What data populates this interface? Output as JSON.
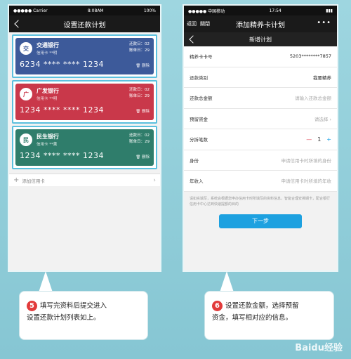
{
  "left": {
    "status": {
      "carrier": "●●●●● Carrier",
      "time": "8:08AM",
      "battery": "100%"
    },
    "title": "设置还款计划",
    "cards": [
      {
        "logo": "交",
        "name": "交通银行",
        "sub": "信用卡      **明",
        "repay_day": "还款日：02",
        "bill_day": "账单日：29",
        "number": "6234 **** **** 1234",
        "delete": "删除"
      },
      {
        "logo": "广",
        "name": "广发银行",
        "sub": "信用卡      **明",
        "repay_day": "还款日：02",
        "bill_day": "账单日：29",
        "number": "1234 **** **** 1234",
        "delete": "删除"
      },
      {
        "logo": "民",
        "name": "民生银行",
        "sub": "信用卡      **薰",
        "repay_day": "还款日：02",
        "bill_day": "账单日：29",
        "number": "1234 **** **** 1234",
        "delete": "删除"
      }
    ],
    "add_card": "添加信用卡"
  },
  "right": {
    "status": {
      "carrier": "●●●●● 中国移动",
      "time": "17:54"
    },
    "nav_back": "返回",
    "nav_close": "關閉",
    "title": "添加精养卡计划",
    "subtitle": "新增计划",
    "rows": [
      {
        "label": "精养卡卡号",
        "value": "5203********7857"
      },
      {
        "label": "还款类别",
        "value": "我要精养"
      },
      {
        "label": "还款总金额",
        "value": "请输入还款总金额"
      },
      {
        "label": "预留资金",
        "value": "请选择"
      },
      {
        "label": "分拆笔数",
        "value": "1"
      },
      {
        "label": "身份",
        "value": "申请信用卡时所填的身份"
      },
      {
        "label": "年收入",
        "value": "申请信用卡时所填的年收"
      }
    ],
    "note": "请如实填写，系统会根据您申办信用卡时所填写的资料信息，智能合理安排期卡，配合银行信用卡中心达到快速提额的目的",
    "next": "下一步"
  },
  "callouts": {
    "left": {
      "num": "5",
      "line1": "填写完资料后提交进入",
      "line2": "设置还款计划列表如上。"
    },
    "right": {
      "num": "6",
      "line1": "设置还款金额，选择预留",
      "line2": "资金，填写相对应的信息。"
    }
  },
  "watermark": "Baidu经验"
}
